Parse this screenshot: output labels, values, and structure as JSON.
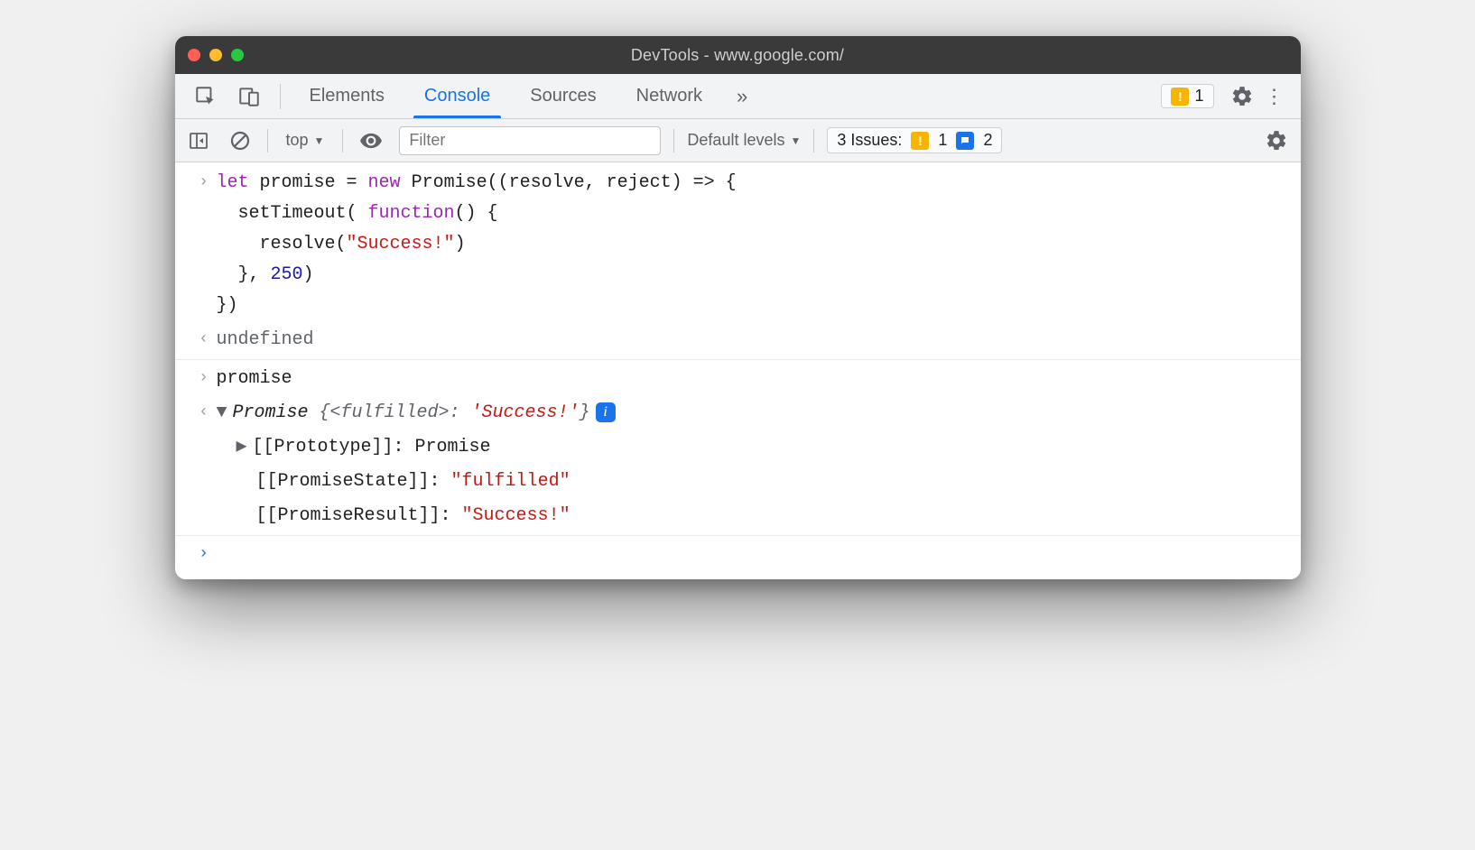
{
  "window": {
    "title": "DevTools - www.google.com/"
  },
  "tabs": {
    "items": [
      "Elements",
      "Console",
      "Sources",
      "Network"
    ],
    "active_index": 1,
    "more_glyph": "»"
  },
  "header_warning": {
    "count": "1"
  },
  "console_toolbar": {
    "context": "top",
    "filter_placeholder": "Filter",
    "levels_label": "Default levels",
    "issues_label": "3 Issues:",
    "issues_warn_count": "1",
    "issues_info_count": "2"
  },
  "code": {
    "l1a": "let",
    "l1b": " promise = ",
    "l1c": "new",
    "l1d": " Promise((resolve, reject) => {",
    "l2a": "  setTimeout( ",
    "l2b": "function",
    "l2c": "() {",
    "l3a": "    resolve(",
    "l3b": "\"Success!\"",
    "l3c": ")",
    "l4a": "  }, ",
    "l4b": "250",
    "l4c": ")",
    "l5": "})",
    "result1": "undefined",
    "input2": "promise",
    "obj_head_a": "Promise ",
    "obj_head_b": "{<fulfilled>: ",
    "obj_head_c": "'Success!'",
    "obj_head_d": "}",
    "proto_label": "[[Prototype]]: ",
    "proto_val": "Promise",
    "state_label": "[[PromiseState]]: ",
    "state_val": "\"fulfilled\"",
    "result_label": "[[PromiseResult]]: ",
    "result_val": "\"Success!\""
  }
}
